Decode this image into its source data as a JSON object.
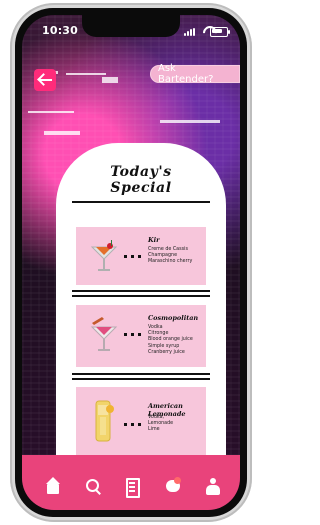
{
  "status_bar": {
    "time": "10:30"
  },
  "header": {
    "ask_bartender": "Ask Bartender?"
  },
  "card": {
    "title_line1": "Today's",
    "title_line2": "Special",
    "items": [
      {
        "name": "Kir",
        "ingredients": [
          "Creme de Cassis",
          "Champagne",
          "Maraschino cherry"
        ]
      },
      {
        "name": "Cosmopolitan",
        "ingredients": [
          "Vodka",
          "Citronge",
          "Blood orange juice",
          "Simple syrup",
          "Cranberry juice"
        ]
      },
      {
        "name": "American Lemonade",
        "ingredients": [
          "Vodka,",
          "Lemonade",
          "Lime"
        ]
      }
    ]
  },
  "icons": {
    "back": "back-arrow-icon",
    "nav": [
      "home-icon",
      "search-icon",
      "book-icon",
      "chat-icon",
      "profile-icon"
    ]
  },
  "colors": {
    "accent_pink": "#e9437b",
    "back_button": "#ff2b7a",
    "item_bg": "#f7c6db",
    "pill_bg": "#f4b3d1"
  }
}
